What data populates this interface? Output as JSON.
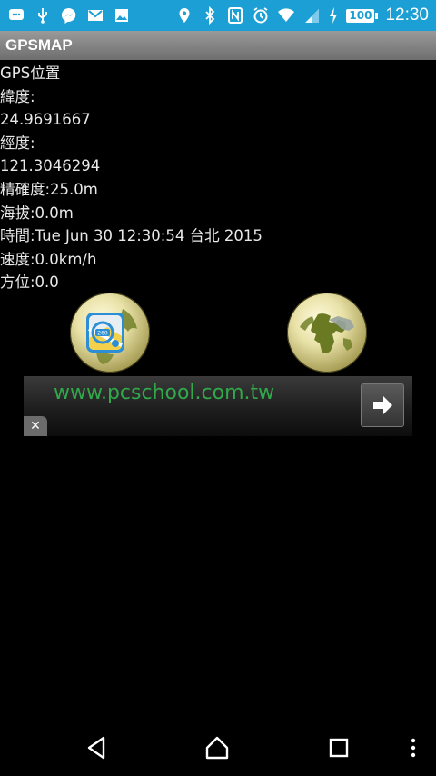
{
  "status_bar": {
    "icons": [
      "chat-icon",
      "usb-icon",
      "messenger-icon",
      "gmail-icon",
      "image-icon",
      "location-icon",
      "bluetooth-icon",
      "nfc-icon",
      "alarm-icon",
      "wifi-icon",
      "signal-icon",
      "charging-icon"
    ],
    "battery": "100",
    "time": "12:30"
  },
  "app": {
    "title": "GPSMAP"
  },
  "gps": {
    "header": "GPS位置",
    "latitude_label": "緯度:",
    "latitude_value": "24.9691667",
    "longitude_label": "經度:",
    "longitude_value": "121.3046294",
    "accuracy": "精確度:25.0m",
    "altitude": "海拔:0.0m",
    "time": "時間:Tue Jun 30 12:30:54 台北 2015",
    "speed": "速度:0.0km/h",
    "bearing": "方位:0.0"
  },
  "buttons": {
    "left_icon": "maps-icon",
    "right_icon": "globe-icon"
  },
  "ad": {
    "url": "www.pcschool.com.tw",
    "close_label": "✕"
  },
  "colors": {
    "status_bar": "#1b9fd4",
    "ad_text": "#31a84a"
  }
}
